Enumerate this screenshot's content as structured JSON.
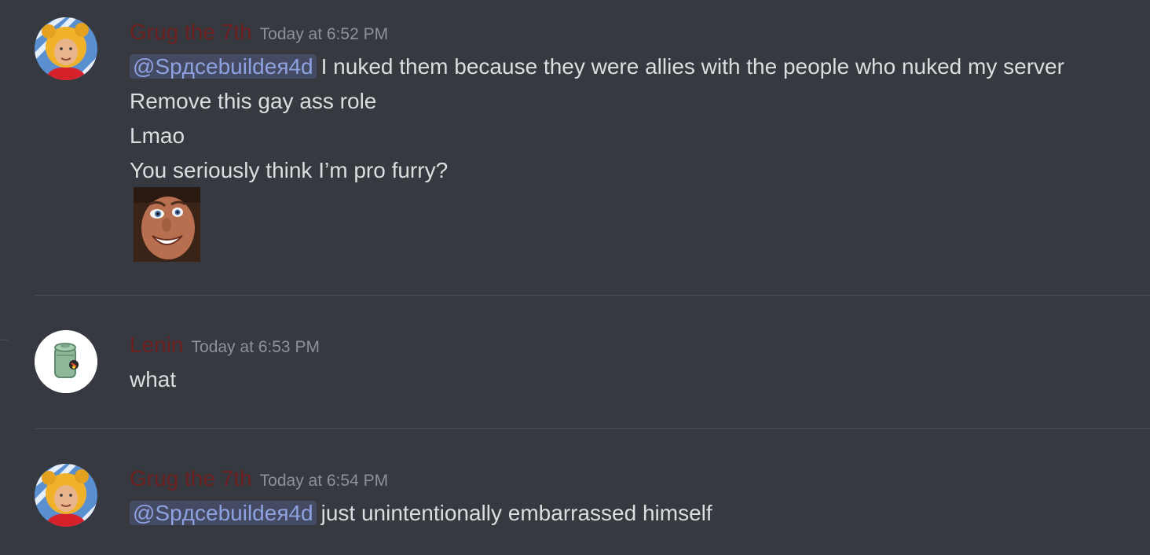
{
  "messages": [
    {
      "username": "Grug the 7th",
      "timestamp": "Today at 6:52 PM",
      "mention": "@Spдcebuildeя4d",
      "lines": [
        "I nuked them because they were allies with the people who nuked my server",
        "Remove this gay ass role",
        "Lmao",
        "You seriously think I’m pro furry?"
      ],
      "avatar_icon": "pooh-avatar-icon",
      "image_icon": "face-emoji-image"
    },
    {
      "username": "Lenin",
      "timestamp": "Today at 6:53 PM",
      "lines": [
        "what"
      ],
      "avatar_icon": "canister-avatar-icon"
    },
    {
      "username": "Grug the 7th",
      "timestamp": "Today at 6:54 PM",
      "mention": "@Spдcebuildeя4d",
      "lines": [
        "just unintentionally embarrassed himself"
      ],
      "avatar_icon": "pooh-avatar-icon"
    }
  ],
  "colors": {
    "background": "#36393f",
    "username": "#6b1f1f",
    "mention_text": "#8ea1e1",
    "timestamp": "#8e9297",
    "message_text": "#dcddde"
  }
}
